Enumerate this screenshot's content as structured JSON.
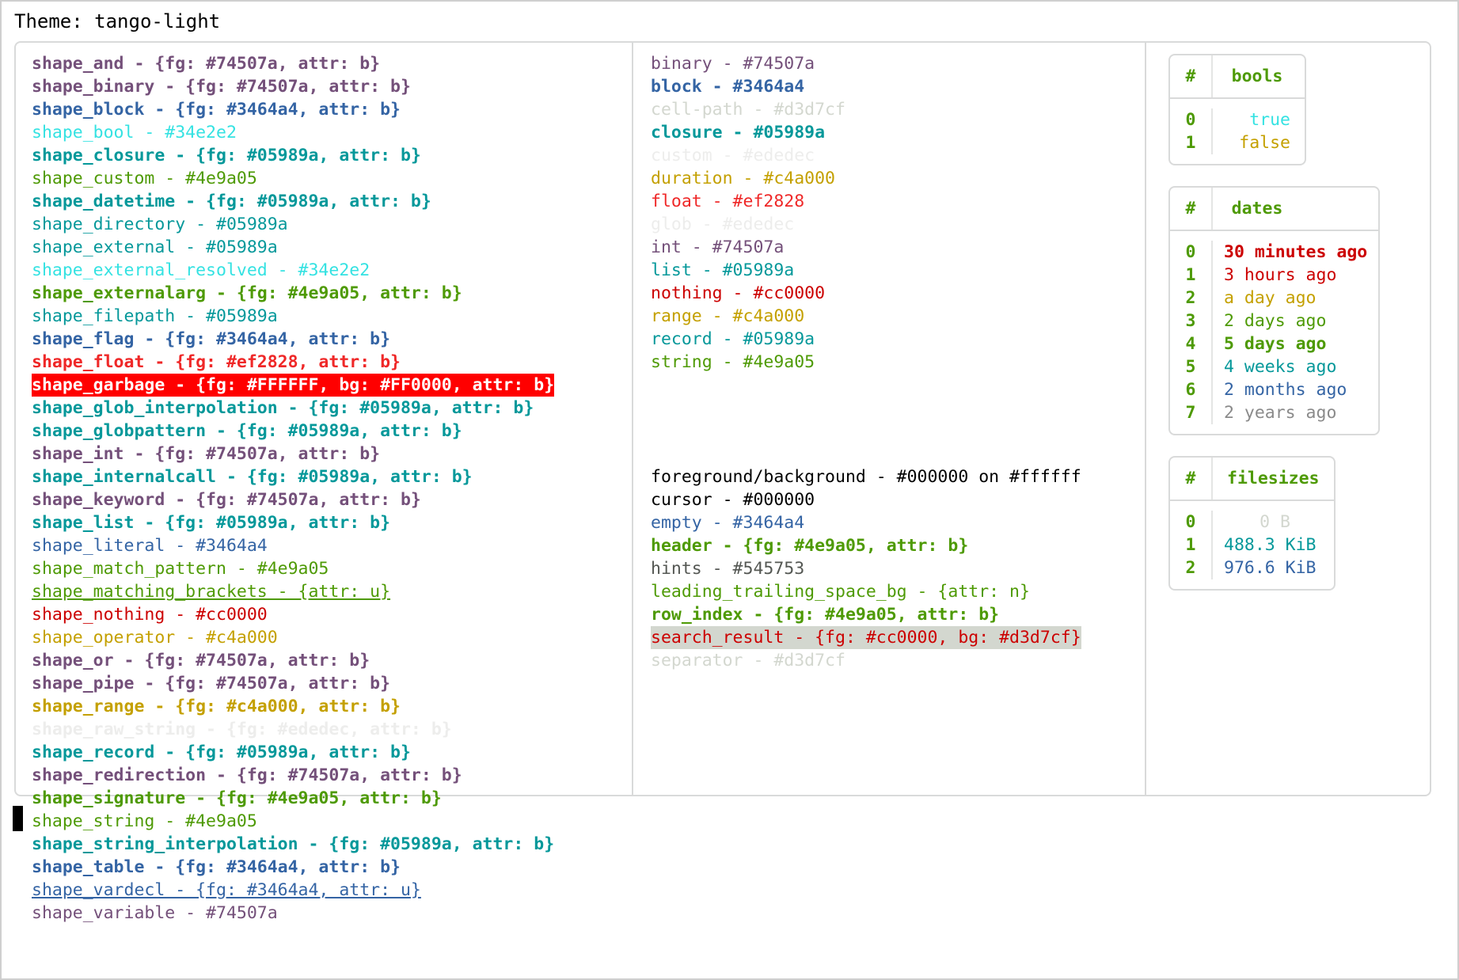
{
  "theme_label": "Theme: tango-light",
  "colors": {
    "purple": "#74507a",
    "blue": "#3464a4",
    "cyan": "#34e2e2",
    "teal": "#05989a",
    "green": "#4e9a05",
    "red_bright": "#ef2828",
    "red_dark": "#cc0000",
    "gold": "#c4a000",
    "faint": "#ededec",
    "gray_light": "#d3d7cf",
    "gray_dark": "#545753",
    "black": "#000000",
    "white": "#ffffff",
    "garbage_bg": "#FF0000",
    "border": "#d9dada"
  },
  "left_column": [
    {
      "text": "shape_and - {fg: #74507a, attr: b}",
      "color": "#74507a",
      "bold": true,
      "underline": false
    },
    {
      "text": "shape_binary - {fg: #74507a, attr: b}",
      "color": "#74507a",
      "bold": true,
      "underline": false
    },
    {
      "text": "shape_block - {fg: #3464a4, attr: b}",
      "color": "#3464a4",
      "bold": true,
      "underline": false
    },
    {
      "text": "shape_bool - #34e2e2",
      "color": "#34e2e2",
      "bold": false,
      "underline": false
    },
    {
      "text": "shape_closure - {fg: #05989a, attr: b}",
      "color": "#05989a",
      "bold": true,
      "underline": false
    },
    {
      "text": "shape_custom - #4e9a05",
      "color": "#4e9a05",
      "bold": false,
      "underline": false
    },
    {
      "text": "shape_datetime - {fg: #05989a, attr: b}",
      "color": "#05989a",
      "bold": true,
      "underline": false
    },
    {
      "text": "shape_directory - #05989a",
      "color": "#05989a",
      "bold": false,
      "underline": false
    },
    {
      "text": "shape_external - #05989a",
      "color": "#05989a",
      "bold": false,
      "underline": false
    },
    {
      "text": "shape_external_resolved - #34e2e2",
      "color": "#34e2e2",
      "bold": false,
      "underline": false
    },
    {
      "text": "shape_externalarg - {fg: #4e9a05, attr: b}",
      "color": "#4e9a05",
      "bold": true,
      "underline": false
    },
    {
      "text": "shape_filepath - #05989a",
      "color": "#05989a",
      "bold": false,
      "underline": false
    },
    {
      "text": "shape_flag - {fg: #3464a4, attr: b}",
      "color": "#3464a4",
      "bold": true,
      "underline": false
    },
    {
      "text": "shape_float - {fg: #ef2828, attr: b}",
      "color": "#ef2828",
      "bold": true,
      "underline": false
    },
    {
      "text": "shape_garbage - {fg: #FFFFFF, bg: #FF0000, attr: b}",
      "color": "#FFFFFF",
      "bg": "#FF0000",
      "bold": true,
      "underline": false
    },
    {
      "text": "shape_glob_interpolation - {fg: #05989a, attr: b}",
      "color": "#05989a",
      "bold": true,
      "underline": false
    },
    {
      "text": "shape_globpattern - {fg: #05989a, attr: b}",
      "color": "#05989a",
      "bold": true,
      "underline": false
    },
    {
      "text": "shape_int - {fg: #74507a, attr: b}",
      "color": "#74507a",
      "bold": true,
      "underline": false
    },
    {
      "text": "shape_internalcall - {fg: #05989a, attr: b}",
      "color": "#05989a",
      "bold": true,
      "underline": false
    },
    {
      "text": "shape_keyword - {fg: #74507a, attr: b}",
      "color": "#74507a",
      "bold": true,
      "underline": false
    },
    {
      "text": "shape_list - {fg: #05989a, attr: b}",
      "color": "#05989a",
      "bold": true,
      "underline": false
    },
    {
      "text": "shape_literal - #3464a4",
      "color": "#3464a4",
      "bold": false,
      "underline": false
    },
    {
      "text": "shape_match_pattern - #4e9a05",
      "color": "#4e9a05",
      "bold": false,
      "underline": false
    },
    {
      "text": "shape_matching_brackets - {attr: u}",
      "color": "#4e9a05",
      "bold": false,
      "underline": true
    },
    {
      "text": "shape_nothing - #cc0000",
      "color": "#cc0000",
      "bold": false,
      "underline": false
    },
    {
      "text": "shape_operator - #c4a000",
      "color": "#c4a000",
      "bold": false,
      "underline": false
    },
    {
      "text": "shape_or - {fg: #74507a, attr: b}",
      "color": "#74507a",
      "bold": true,
      "underline": false
    },
    {
      "text": "shape_pipe - {fg: #74507a, attr: b}",
      "color": "#74507a",
      "bold": true,
      "underline": false
    },
    {
      "text": "shape_range - {fg: #c4a000, attr: b}",
      "color": "#c4a000",
      "bold": true,
      "underline": false
    },
    {
      "text": "shape_raw_string - {fg: #ededec, attr: b}",
      "color": "#ededec",
      "bold": true,
      "underline": false
    },
    {
      "text": "shape_record - {fg: #05989a, attr: b}",
      "color": "#05989a",
      "bold": true,
      "underline": false
    },
    {
      "text": "shape_redirection - {fg: #74507a, attr: b}",
      "color": "#74507a",
      "bold": true,
      "underline": false
    },
    {
      "text": "shape_signature - {fg: #4e9a05, attr: b}",
      "color": "#4e9a05",
      "bold": true,
      "underline": false
    },
    {
      "text": "shape_string - #4e9a05",
      "color": "#4e9a05",
      "bold": false,
      "underline": false
    },
    {
      "text": "shape_string_interpolation - {fg: #05989a, attr: b}",
      "color": "#05989a",
      "bold": true,
      "underline": false
    },
    {
      "text": "shape_table - {fg: #3464a4, attr: b}",
      "color": "#3464a4",
      "bold": true,
      "underline": false
    },
    {
      "text": "shape_vardecl - {fg: #3464a4, attr: u}",
      "color": "#3464a4",
      "bold": false,
      "underline": true
    },
    {
      "text": "shape_variable - #74507a",
      "color": "#74507a",
      "bold": false,
      "underline": false
    }
  ],
  "middle_column_top": [
    {
      "text": "binary - #74507a",
      "color": "#74507a",
      "bold": false,
      "underline": false
    },
    {
      "text": "block - #3464a4",
      "color": "#3464a4",
      "bold": true,
      "underline": false
    },
    {
      "text": "cell-path - #d3d7cf",
      "color": "#d3d7cf",
      "bold": false,
      "underline": false
    },
    {
      "text": "closure - #05989a",
      "color": "#05989a",
      "bold": true,
      "underline": false
    },
    {
      "text": "custom - #ededec",
      "color": "#ededec",
      "bold": false,
      "underline": false
    },
    {
      "text": "duration - #c4a000",
      "color": "#c4a000",
      "bold": false,
      "underline": false
    },
    {
      "text": "float - #ef2828",
      "color": "#ef2828",
      "bold": false,
      "underline": false
    },
    {
      "text": "glob - #ededec",
      "color": "#ededec",
      "bold": false,
      "underline": false
    },
    {
      "text": "int - #74507a",
      "color": "#74507a",
      "bold": false,
      "underline": false
    },
    {
      "text": "list - #05989a",
      "color": "#05989a",
      "bold": false,
      "underline": false
    },
    {
      "text": "nothing - #cc0000",
      "color": "#cc0000",
      "bold": false,
      "underline": false
    },
    {
      "text": "range - #c4a000",
      "color": "#c4a000",
      "bold": false,
      "underline": false
    },
    {
      "text": "record - #05989a",
      "color": "#05989a",
      "bold": false,
      "underline": false
    },
    {
      "text": "string - #4e9a05",
      "color": "#4e9a05",
      "bold": false,
      "underline": false
    }
  ],
  "middle_column_bottom": [
    {
      "text": "foreground/background - #000000 on #ffffff",
      "color": "#000000",
      "bold": false,
      "underline": false
    },
    {
      "text": "cursor - #000000",
      "color": "#000000",
      "bold": false,
      "underline": false
    },
    {
      "text": "empty - #3464a4",
      "color": "#3464a4",
      "bold": false,
      "underline": false
    },
    {
      "text": "header - {fg: #4e9a05, attr: b}",
      "color": "#4e9a05",
      "bold": true,
      "underline": false
    },
    {
      "text": "hints - #545753",
      "color": "#545753",
      "bold": false,
      "underline": false
    },
    {
      "text": "leading_trailing_space_bg - {attr: n}",
      "color": "#4e9a05",
      "bold": false,
      "underline": false
    },
    {
      "text": "row_index - {fg: #4e9a05, attr: b}",
      "color": "#4e9a05",
      "bold": true,
      "underline": false
    },
    {
      "text": "search_result - {fg: #cc0000, bg: #d3d7cf}",
      "color": "#cc0000",
      "bg": "#d3d7cf",
      "bold": false,
      "underline": false
    },
    {
      "text": "separator - #d3d7cf",
      "color": "#d3d7cf",
      "bold": false,
      "underline": false
    }
  ],
  "tables": [
    {
      "name": "bools",
      "index_header": "#",
      "value_header": "bools",
      "rows": [
        {
          "index": "0",
          "value": "true",
          "color": "#34e2e2",
          "bold": false
        },
        {
          "index": "1",
          "value": "false",
          "color": "#c4a000",
          "bold": false
        }
      ]
    },
    {
      "name": "dates",
      "index_header": "#",
      "value_header": "dates",
      "rows": [
        {
          "index": "0",
          "value": "30 minutes ago",
          "color": "#cc0000",
          "bold": true
        },
        {
          "index": "1",
          "value": "3 hours ago",
          "color": "#cc0000",
          "bold": false
        },
        {
          "index": "2",
          "value": "a day ago",
          "color": "#c4a000",
          "bold": false
        },
        {
          "index": "3",
          "value": "2 days ago",
          "color": "#4e9a05",
          "bold": false
        },
        {
          "index": "4",
          "value": "5 days ago",
          "color": "#4e9a05",
          "bold": true
        },
        {
          "index": "5",
          "value": "4 weeks ago",
          "color": "#05989a",
          "bold": false
        },
        {
          "index": "6",
          "value": "2 months ago",
          "color": "#3464a4",
          "bold": false
        },
        {
          "index": "7",
          "value": "2 years ago",
          "color": "#8a8a8a",
          "bold": false
        }
      ]
    },
    {
      "name": "filesizes",
      "index_header": "#",
      "value_header": "filesizes",
      "rows": [
        {
          "index": "0",
          "value": "0 B",
          "color": "#d3d7cf",
          "bold": false
        },
        {
          "index": "1",
          "value": "488.3 KiB",
          "color": "#05989a",
          "bold": false
        },
        {
          "index": "2",
          "value": "976.6 KiB",
          "color": "#3464a4",
          "bold": false
        }
      ]
    }
  ]
}
